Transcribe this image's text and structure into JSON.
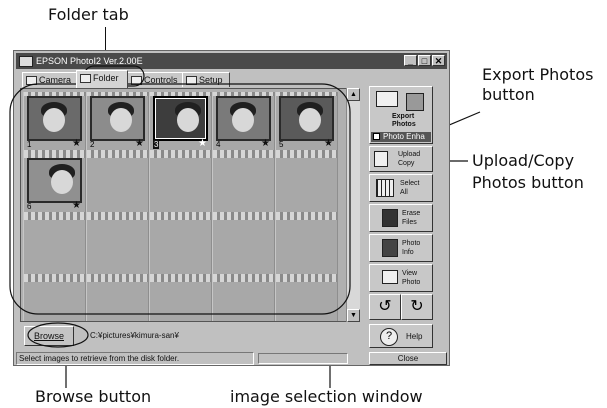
{
  "callouts": {
    "folder_tab": "Folder tab",
    "export_photos": [
      "Export Photos",
      "button"
    ],
    "upload_copy": [
      "Upload/Copy",
      "Photos button"
    ],
    "browse": "Browse button",
    "image_selection": "image selection window"
  },
  "window": {
    "title": "EPSON PhotoI2 Ver.2.00E",
    "minimize": "_",
    "maximize": "□",
    "close": "✕"
  },
  "tabs": [
    {
      "label": "Camera",
      "icon": "camera-icon"
    },
    {
      "label": "Folder",
      "icon": "folder-icon"
    },
    {
      "label": "Controls",
      "icon": "controls-icon"
    },
    {
      "label": "Setup",
      "icon": "setup-icon"
    }
  ],
  "thumbnails": [
    {
      "number": "1",
      "star": "★",
      "icon": "photo-thumbnail"
    },
    {
      "number": "2",
      "star": "★",
      "icon": "photo-thumbnail"
    },
    {
      "number": "3",
      "star": "★",
      "icon": "photo-thumbnail",
      "selected": true
    },
    {
      "number": "4",
      "star": "★",
      "icon": "photo-thumbnail"
    },
    {
      "number": "5",
      "star": "★",
      "icon": "photo-thumbnail"
    },
    {
      "number": "6",
      "star": "★",
      "icon": "photo-thumbnail"
    }
  ],
  "side": {
    "export_line1": "Export",
    "export_line2": "Photos",
    "photo_enha": "Photo Enha",
    "upload": "Upload",
    "copy": "Copy",
    "select_all": [
      "Select",
      "All"
    ],
    "erase_files": [
      "Erase",
      "Files"
    ],
    "photo_info": [
      "Photo",
      "Info"
    ],
    "view_photo": [
      "View",
      "Photo"
    ],
    "help": "Help"
  },
  "browse": {
    "label": "Browse",
    "path": "C:¥pictures¥kimura-san¥"
  },
  "status": {
    "text": "Select images to retrieve from the disk folder.",
    "close": "Close"
  },
  "colors": {
    "titlebar": "#4a4a4a",
    "window": "#c0c0c0",
    "panel": "#b0b0b0"
  }
}
